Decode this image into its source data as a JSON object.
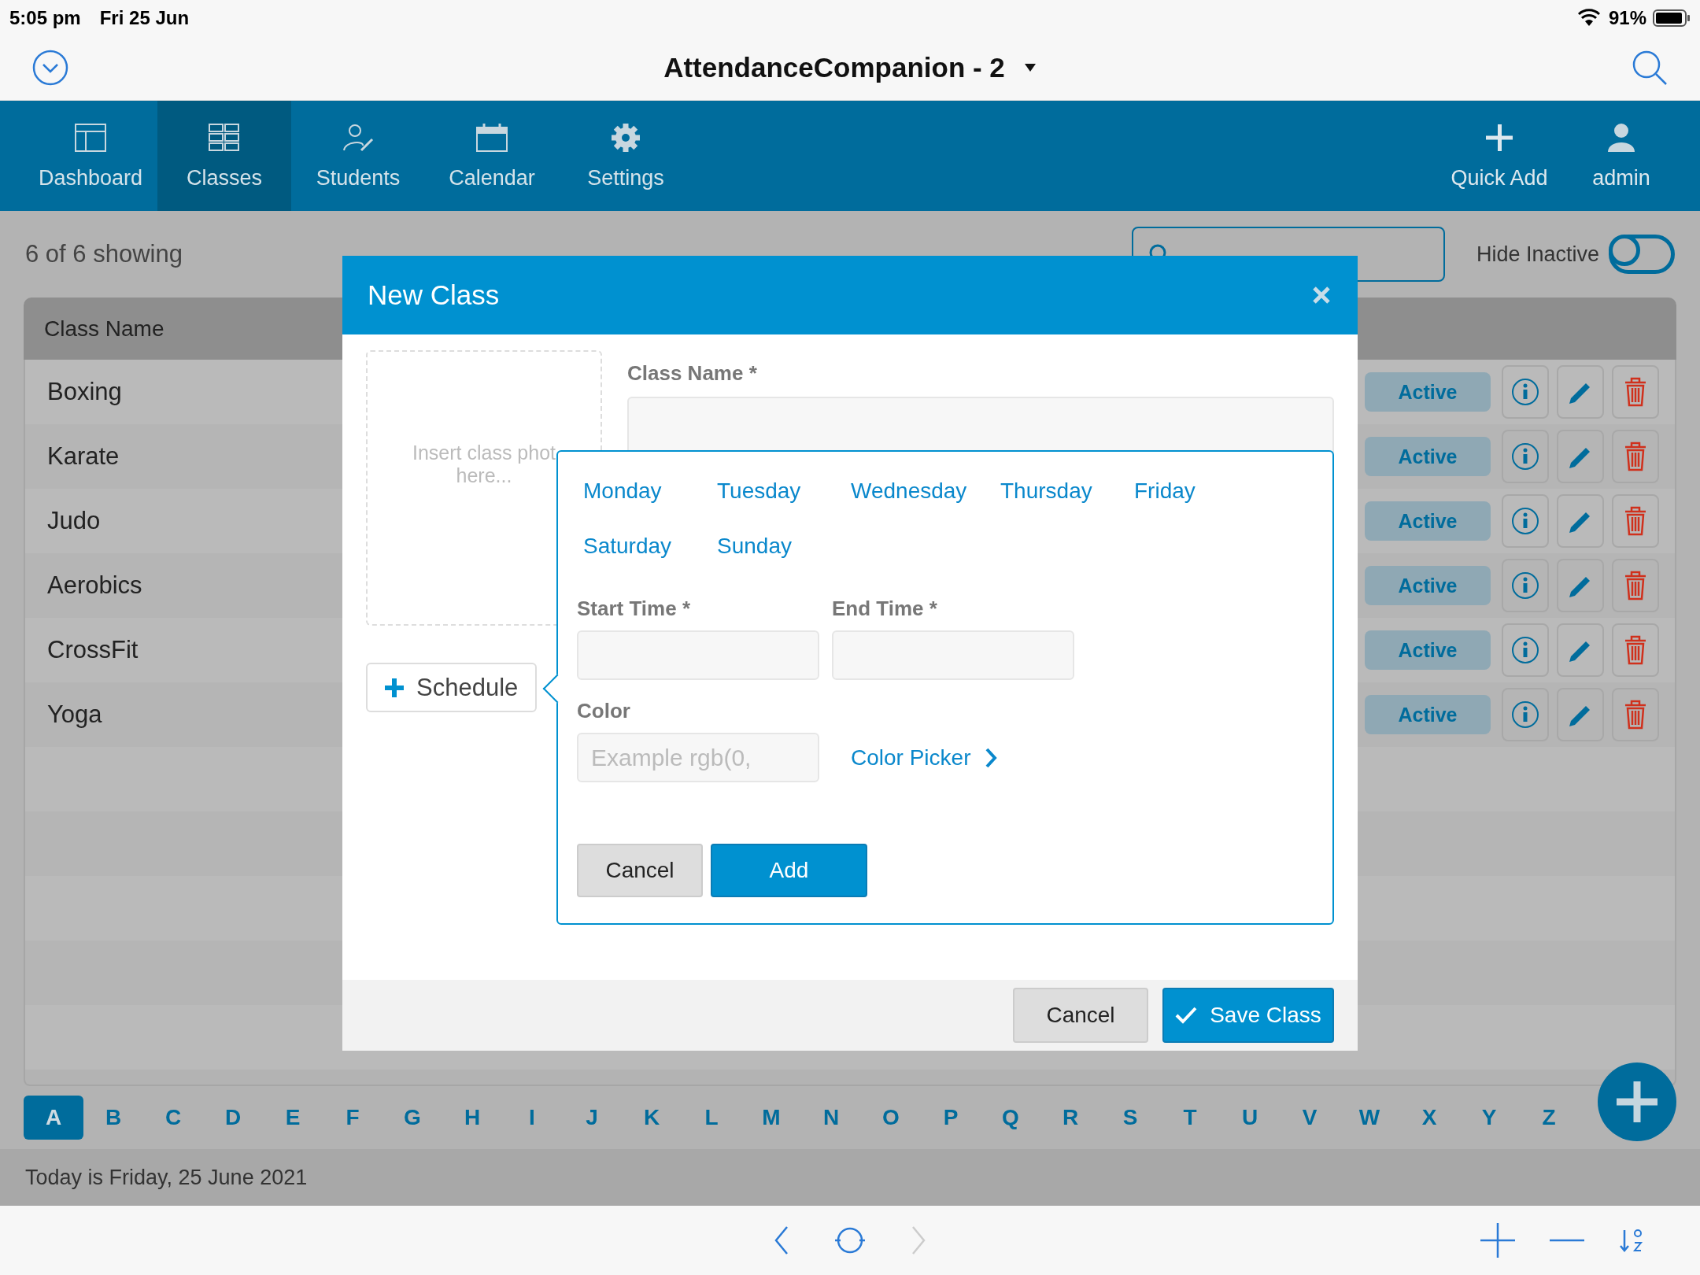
{
  "status_bar": {
    "time": "5:05 pm",
    "date": "Fri 25 Jun",
    "battery": "91%"
  },
  "title_bar": {
    "title": "AttendanceCompanion - 2"
  },
  "nav": {
    "tabs": [
      {
        "label": "Dashboard",
        "selected": false
      },
      {
        "label": "Classes",
        "selected": true
      },
      {
        "label": "Students",
        "selected": false
      },
      {
        "label": "Calendar",
        "selected": false
      },
      {
        "label": "Settings",
        "selected": false
      }
    ],
    "actions": [
      "Quick Add",
      "admin"
    ]
  },
  "toolbar": {
    "count": "6 of 6 showing",
    "hide_inactive": {
      "label": "Hide Inactive",
      "on": false
    }
  },
  "table": {
    "columns": [
      "Class Name"
    ],
    "rows": [
      {
        "name": "Boxing",
        "status": "Active"
      },
      {
        "name": "Karate",
        "status": "Active"
      },
      {
        "name": "Judo",
        "status": "Active"
      },
      {
        "name": "Aerobics",
        "status": "Active"
      },
      {
        "name": "CrossFit",
        "status": "Active"
      },
      {
        "name": "Yoga",
        "status": "Active"
      }
    ]
  },
  "alphabet": [
    {
      "letter": "A",
      "selected": true
    },
    {
      "letter": "B",
      "selected": false
    },
    {
      "letter": "C",
      "selected": false
    },
    {
      "letter": "D",
      "selected": false
    },
    {
      "letter": "E",
      "selected": false
    },
    {
      "letter": "F",
      "selected": false
    },
    {
      "letter": "G",
      "selected": false
    },
    {
      "letter": "H",
      "selected": false
    },
    {
      "letter": "I",
      "selected": false
    },
    {
      "letter": "J",
      "selected": false
    },
    {
      "letter": "K",
      "selected": false
    },
    {
      "letter": "L",
      "selected": false
    },
    {
      "letter": "M",
      "selected": false
    },
    {
      "letter": "N",
      "selected": false
    },
    {
      "letter": "O",
      "selected": false
    },
    {
      "letter": "P",
      "selected": false
    },
    {
      "letter": "Q",
      "selected": false
    },
    {
      "letter": "R",
      "selected": false
    },
    {
      "letter": "S",
      "selected": false
    },
    {
      "letter": "T",
      "selected": false
    },
    {
      "letter": "U",
      "selected": false
    },
    {
      "letter": "V",
      "selected": false
    },
    {
      "letter": "W",
      "selected": false
    },
    {
      "letter": "X",
      "selected": false
    },
    {
      "letter": "Y",
      "selected": false
    },
    {
      "letter": "Z",
      "selected": false
    }
  ],
  "footer": "Today is Friday, 25 June 2021",
  "bottom_toolbar": {
    "forward_disabled": true
  },
  "modal": {
    "title": "New Class",
    "photo_hint": [
      "Insert class phot",
      "here..."
    ],
    "schedule_button": "Schedule",
    "class_name_label": "Class Name *",
    "schedule": {
      "days": [
        "Monday",
        "Tuesday",
        "Wednesday",
        "Thursday",
        "Friday",
        "Saturday",
        "Sunday"
      ],
      "start_label": "Start Time *",
      "end_label": "End Time *",
      "color_label": "Color",
      "color_placeholder": "Example rgb(0,",
      "color_picker": "Color Picker",
      "cancel": "Cancel",
      "add": "Add"
    },
    "cancel": "Cancel",
    "save": "Save Class"
  }
}
